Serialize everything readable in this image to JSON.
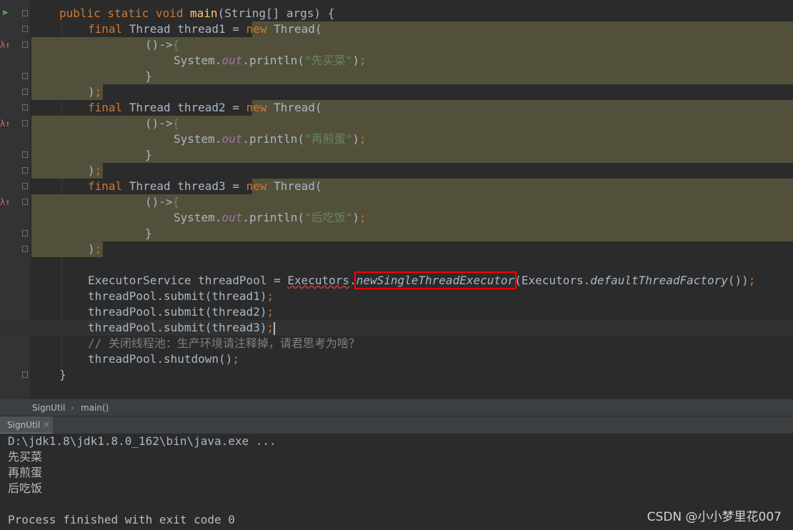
{
  "editor": {
    "lines": {
      "l1": {
        "a": "public static void ",
        "b": "main",
        "c": "(String[] args) {"
      },
      "l2": {
        "a": "final ",
        "b": "Thread thread1 = ",
        "c": "new ",
        "d": "Thread("
      },
      "l3": {
        "a": "()->",
        "b": "{"
      },
      "l4": {
        "a": "System.",
        "b": "out",
        "c": ".println(",
        "d": "\"先买菜\"",
        "e": ")",
        "f": ";"
      },
      "l5": {
        "a": "}"
      },
      "l6": {
        "a": ")",
        "b": ";"
      },
      "l7": {
        "a": "final ",
        "b": "Thread thread2 = ",
        "c": "new ",
        "d": "Thread("
      },
      "l8": {
        "a": "()->",
        "b": "{"
      },
      "l9": {
        "a": "System.",
        "b": "out",
        "c": ".println(",
        "d": "\"再煎蛋\"",
        "e": ")",
        "f": ";"
      },
      "l10": {
        "a": "}"
      },
      "l11": {
        "a": ")",
        "b": ";"
      },
      "l12": {
        "a": "final ",
        "b": "Thread thread3 = ",
        "c": "new ",
        "d": "Thread("
      },
      "l13": {
        "a": "()->",
        "b": "{"
      },
      "l14": {
        "a": "System.",
        "b": "out",
        "c": ".println(",
        "d": "\"后吃饭\"",
        "e": ")",
        "f": ";"
      },
      "l15": {
        "a": "}"
      },
      "l16": {
        "a": ")",
        "b": ";"
      },
      "l18": {
        "a": "ExecutorService threadPool = ",
        "b": "Executors",
        "c": ".",
        "d": "newSingleThreadExecutor",
        "e": "(Executors.",
        "f": "defaultThreadFactory",
        "g": "())",
        "h": ";"
      },
      "l19": {
        "a": "threadPool.submit(thread1)",
        "b": ";"
      },
      "l20": {
        "a": "threadPool.submit(thread2)",
        "b": ";"
      },
      "l21": {
        "a": "threadPool.submit(thread3)",
        "b": ";"
      },
      "l22": {
        "a": "// 关闭线程池：生产环境请注释掉，请君思考为啥？"
      },
      "l23": {
        "a": "threadPool.shutdown()",
        "b": ";"
      },
      "l24": {
        "a": "}"
      }
    }
  },
  "icons": {
    "run": "run-arrow-icon",
    "lambda": "lambda-breakpoint-icon",
    "fold": "fold-marker-icon"
  },
  "breadcrumb": {
    "class_name": "SignUtil",
    "separator": "›",
    "method": "main()"
  },
  "run_tab": {
    "label": "SignUtil",
    "close": "×"
  },
  "console": {
    "command": "D:\\jdk1.8\\jdk1.8.0_162\\bin\\java.exe ...",
    "output": [
      "先买菜",
      "再煎蛋",
      "后吃饭"
    ],
    "exit": "Process finished with exit code 0"
  },
  "watermark": "CSDN @小小梦里花007",
  "colors": {
    "background": "#2b2b2b",
    "keyword": "#cc7832",
    "string": "#6a8759",
    "method_decl": "#ffc66d",
    "field": "#9876aa",
    "comment": "#808080",
    "highlight": "#52503a",
    "red_box": "#ff0000"
  }
}
